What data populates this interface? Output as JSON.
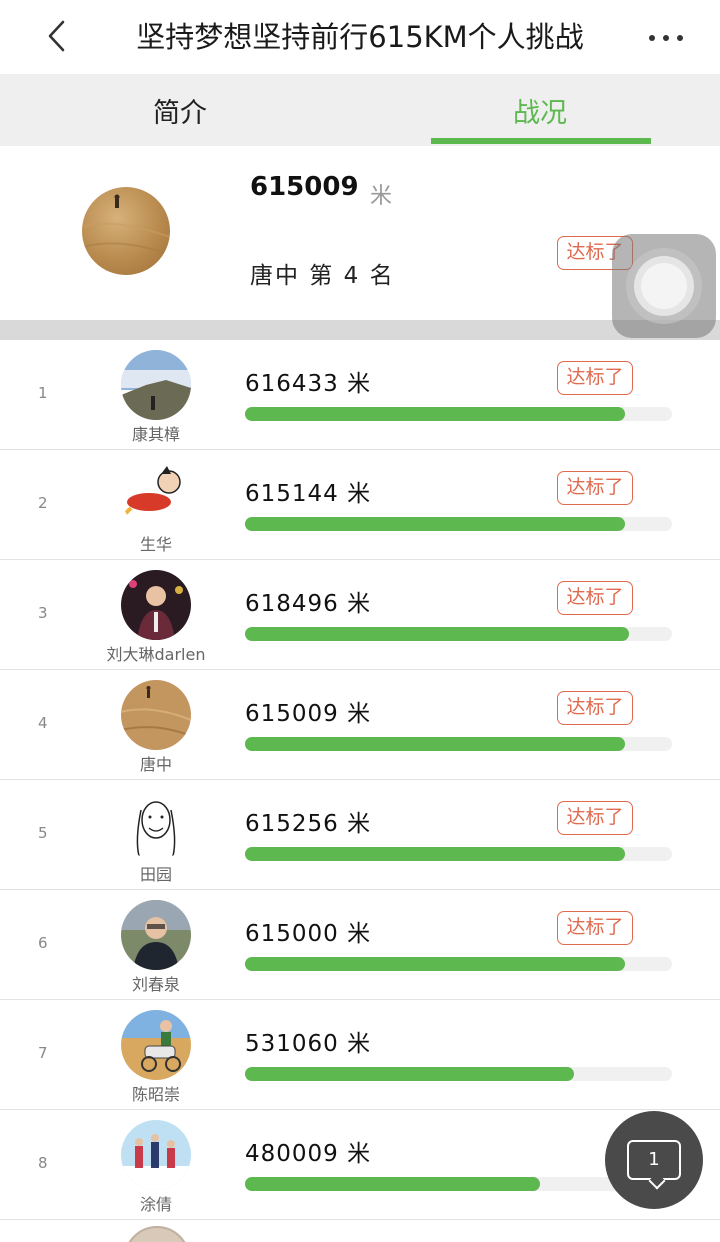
{
  "header": {
    "title": "坚持梦想坚持前行615KM个人挑战",
    "back_icon": "chevron-left-icon",
    "more_icon": "more-horizontal-icon"
  },
  "tabs": [
    {
      "label": "简介",
      "active": false
    },
    {
      "label": "战况",
      "active": true
    }
  ],
  "my_stats": {
    "distance": "615009",
    "unit": "米",
    "rank_text": "唐中   第 4 名",
    "badge": "达标了"
  },
  "colors": {
    "accent": "#5cb84f",
    "badge": "#e06a4f",
    "track": "#f0f0f0"
  },
  "ranking": [
    {
      "rank": "1",
      "name": "康其樟",
      "distance": "616433 米",
      "badge": "达标了",
      "progress": 0.89,
      "avatar": "sky-landscape"
    },
    {
      "rank": "2",
      "name": "生华",
      "distance": "615144 米",
      "badge": "达标了",
      "progress": 0.89,
      "avatar": "cartoon"
    },
    {
      "rank": "3",
      "name": "刘大琳darlen",
      "distance": "618496 米",
      "badge": "达标了",
      "progress": 0.9,
      "avatar": "portrait-dark"
    },
    {
      "rank": "4",
      "name": "唐中",
      "distance": "615009 米",
      "badge": "达标了",
      "progress": 0.89,
      "avatar": "desert"
    },
    {
      "rank": "5",
      "name": "田园",
      "distance": "615256 米",
      "badge": "达标了",
      "progress": 0.89,
      "avatar": "sketch"
    },
    {
      "rank": "6",
      "name": "刘春泉",
      "distance": "615000 米",
      "badge": "达标了",
      "progress": 0.89,
      "avatar": "portrait-suit"
    },
    {
      "rank": "7",
      "name": "陈昭崇",
      "distance": "531060 米",
      "badge": "",
      "progress": 0.77,
      "avatar": "desert-rider"
    },
    {
      "rank": "8",
      "name": "涂倩",
      "distance": "480009 米",
      "badge": "",
      "progress": 0.69,
      "avatar": "snow-group"
    }
  ],
  "chat": {
    "count": "1",
    "icon": "chat-bubble-icon"
  },
  "assistive_icon": "assistive-touch-icon"
}
